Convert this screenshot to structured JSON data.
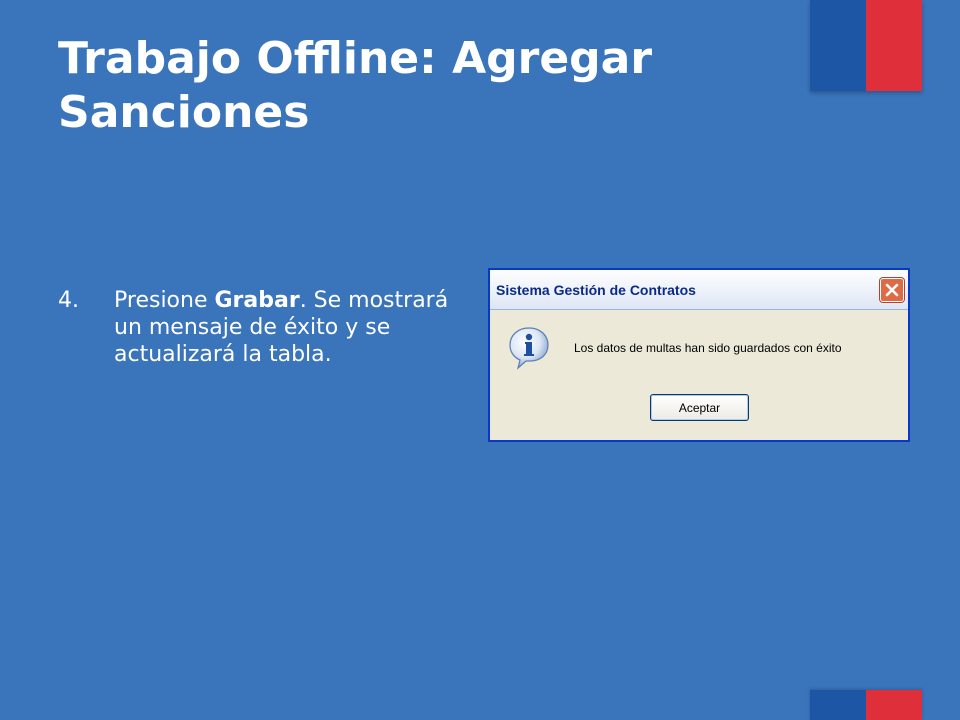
{
  "slide": {
    "title": "Trabajo Offline: Agregar Sanciones",
    "step_number": "4.",
    "step_text_before": "Presione ",
    "step_text_bold": "Grabar",
    "step_text_after": ". Se mostrará un mensaje de éxito y se actualizará la tabla."
  },
  "dialog": {
    "title": "Sistema Gestión de Contratos",
    "message": "Los datos de multas han sido guardados con éxito",
    "ok_button": "Aceptar",
    "icon": "info-icon",
    "close_icon": "close-icon"
  },
  "colors": {
    "background": "#3a74bb",
    "flag_blue": "#1c56a5",
    "flag_red": "#de2f3a"
  }
}
